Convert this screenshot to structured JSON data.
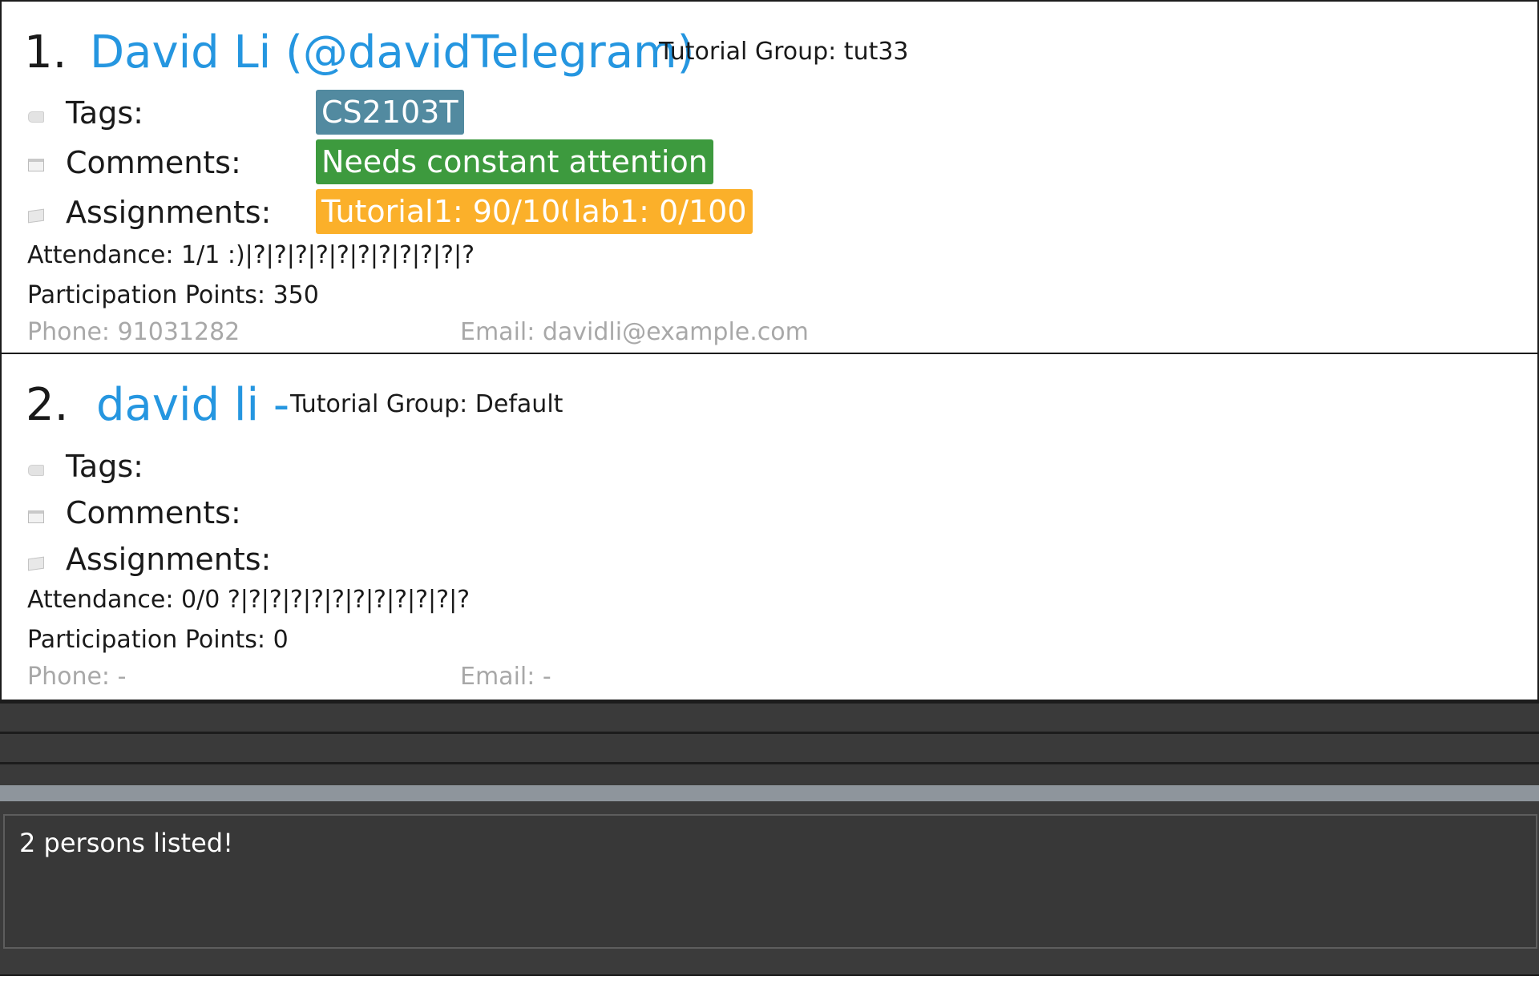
{
  "persons": [
    {
      "index": "1.",
      "name": "David Li (@davidTelegram)",
      "tutorial_group": "Tutorial Group: tut33",
      "tags_label": "Tags:",
      "comments_label": "Comments:",
      "assignments_label": "Assignments:",
      "tags": [
        "CS2103T"
      ],
      "comments": [
        "Needs constant attention"
      ],
      "assignments": [
        "Tutorial1: 90/100",
        "lab1: 0/100"
      ],
      "attendance": "Attendance: 1/1  :)|?|?|?|?|?|?|?|?|?|?|?",
      "participation": "Participation Points: 350",
      "phone": "Phone: 91031282",
      "email": "Email: davidli@example.com"
    },
    {
      "index": "2.",
      "name": "david li -",
      "tutorial_group": "Tutorial Group: Default",
      "tags_label": "Tags:",
      "comments_label": "Comments:",
      "assignments_label": "Assignments:",
      "tags": [],
      "comments": [],
      "assignments": [],
      "attendance": "Attendance: 0/0  ?|?|?|?|?|?|?|?|?|?|?|?",
      "participation": "Participation Points: 0",
      "phone": "Phone:  -",
      "email": "Email:  -"
    }
  ],
  "result_display": {
    "message": "2 persons listed!"
  },
  "command_box": {
    "value": ""
  },
  "colors": {
    "name": "#2596e0",
    "tag_chip": "#528aa0",
    "comment_chip": "#3d9a3e",
    "assignment_chip": "#fbb02a",
    "contact_text": "#a8a8a8",
    "dark_panel": "#3a3a3a"
  },
  "icons": {
    "tags": "tag-icon",
    "comments": "notepad-icon",
    "assignments": "paper-icon"
  }
}
